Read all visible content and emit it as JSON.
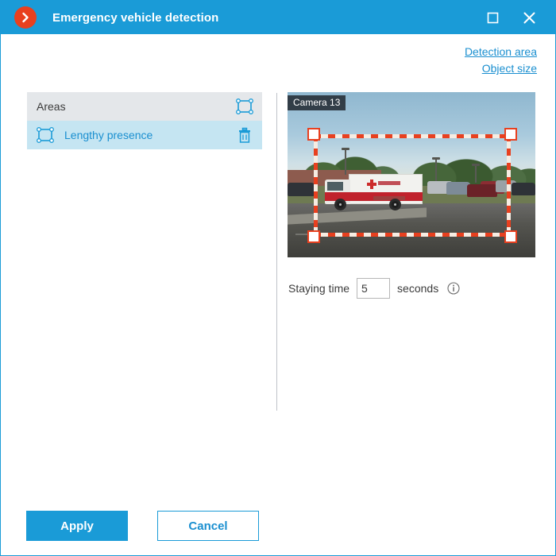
{
  "window": {
    "title": "Emergency vehicle detection",
    "logo_icon": "chevron-right-circle-icon",
    "controls": {
      "maximize_icon": "maximize-icon",
      "close_icon": "close-icon"
    },
    "accent_color": "#1a9bd7",
    "logo_color": "#e8401f"
  },
  "top_links": [
    {
      "label": "Detection area",
      "name": "detection-area-link"
    },
    {
      "label": "Object size",
      "name": "object-size-link"
    }
  ],
  "areas_panel": {
    "header_label": "Areas",
    "add_area_icon": "add-area-icon",
    "rows": [
      {
        "label": "Lengthy presence",
        "area_icon": "area-icon",
        "delete_icon": "trash-icon",
        "selected": true,
        "selected_color": "#c5e5f2"
      }
    ]
  },
  "preview": {
    "camera_label": "Camera 13",
    "detection_rect": {
      "stroke_color": "#e8401f",
      "handle_fill": "#ffffff",
      "handles": [
        "top-left",
        "top-right",
        "bottom-left",
        "bottom-right"
      ]
    }
  },
  "staying_time": {
    "label": "Staying time",
    "value": "5",
    "placeholder": "",
    "unit": "seconds",
    "info_icon": "info-icon"
  },
  "footer": {
    "apply_label": "Apply",
    "cancel_label": "Cancel"
  }
}
